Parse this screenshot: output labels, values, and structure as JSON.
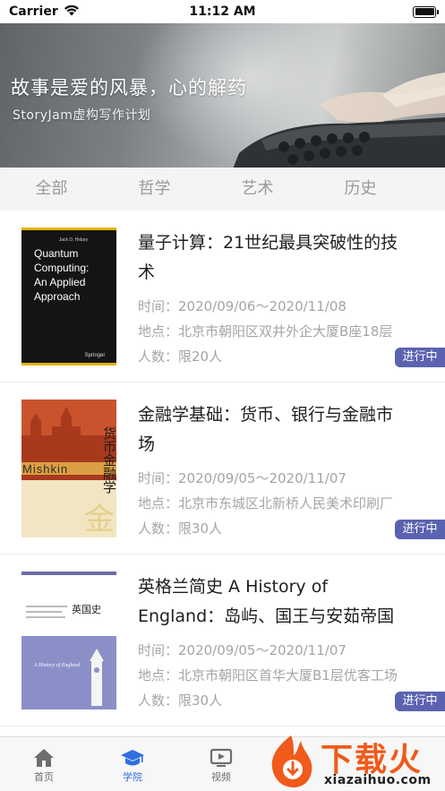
{
  "status_bar": {
    "carrier": "Carrier",
    "time": "11:12 AM"
  },
  "banner": {
    "title": "故事是爱的风暴，心的解药",
    "subtitle": "StoryJam虚构写作计划",
    "page_count": 3,
    "active_page": 1
  },
  "categories": [
    "全部",
    "哲学",
    "艺术",
    "历史"
  ],
  "events": [
    {
      "title": "量子计算：21世纪最具突破性的技术",
      "time": "时间：2020/09/06～2020/11/08",
      "place": "地点：北京市朝阳区双井外企大厦B座18层",
      "people": "人数：限20人",
      "status": "进行中",
      "cover": {
        "author": "Jack D. Hidary",
        "line1": "Quantum",
        "line2": "Computing:",
        "line3": "An Applied",
        "line4": "Approach",
        "publisher": "Springer"
      }
    },
    {
      "title": "金融学基础：货币、银行与金融市场",
      "time": "时间：2020/09/05～2020/11/07",
      "place": "地点：北京市东城区北新桥人民美术印刷厂",
      "people": "人数：限30人",
      "status": "进行中",
      "cover": {
        "title_cn": "货币金融学",
        "author": "Mishkin",
        "big_char": "金"
      }
    },
    {
      "title": "英格兰简史 A History of England：岛屿、国王与安茹帝国",
      "time": "时间：2020/09/05～2020/11/07",
      "place": "地点：北京市朝阳区首华大厦B1层优客工场",
      "people": "人数：限30人",
      "status": "进行中",
      "cover": {
        "title_cn": "英国史",
        "subtitle": "A History of England"
      }
    }
  ],
  "tabbar": [
    {
      "label": "首页",
      "icon": "home-icon"
    },
    {
      "label": "学院",
      "icon": "graduation-cap-icon"
    },
    {
      "label": "视频",
      "icon": "video-icon"
    }
  ],
  "active_tab": "学院",
  "watermark": {
    "text": "下载火",
    "url": "xiazaihuo.com"
  },
  "colors": {
    "accent": "#2f6fe0",
    "badge": "#5b63b0",
    "watermark": "#f05a1a"
  }
}
